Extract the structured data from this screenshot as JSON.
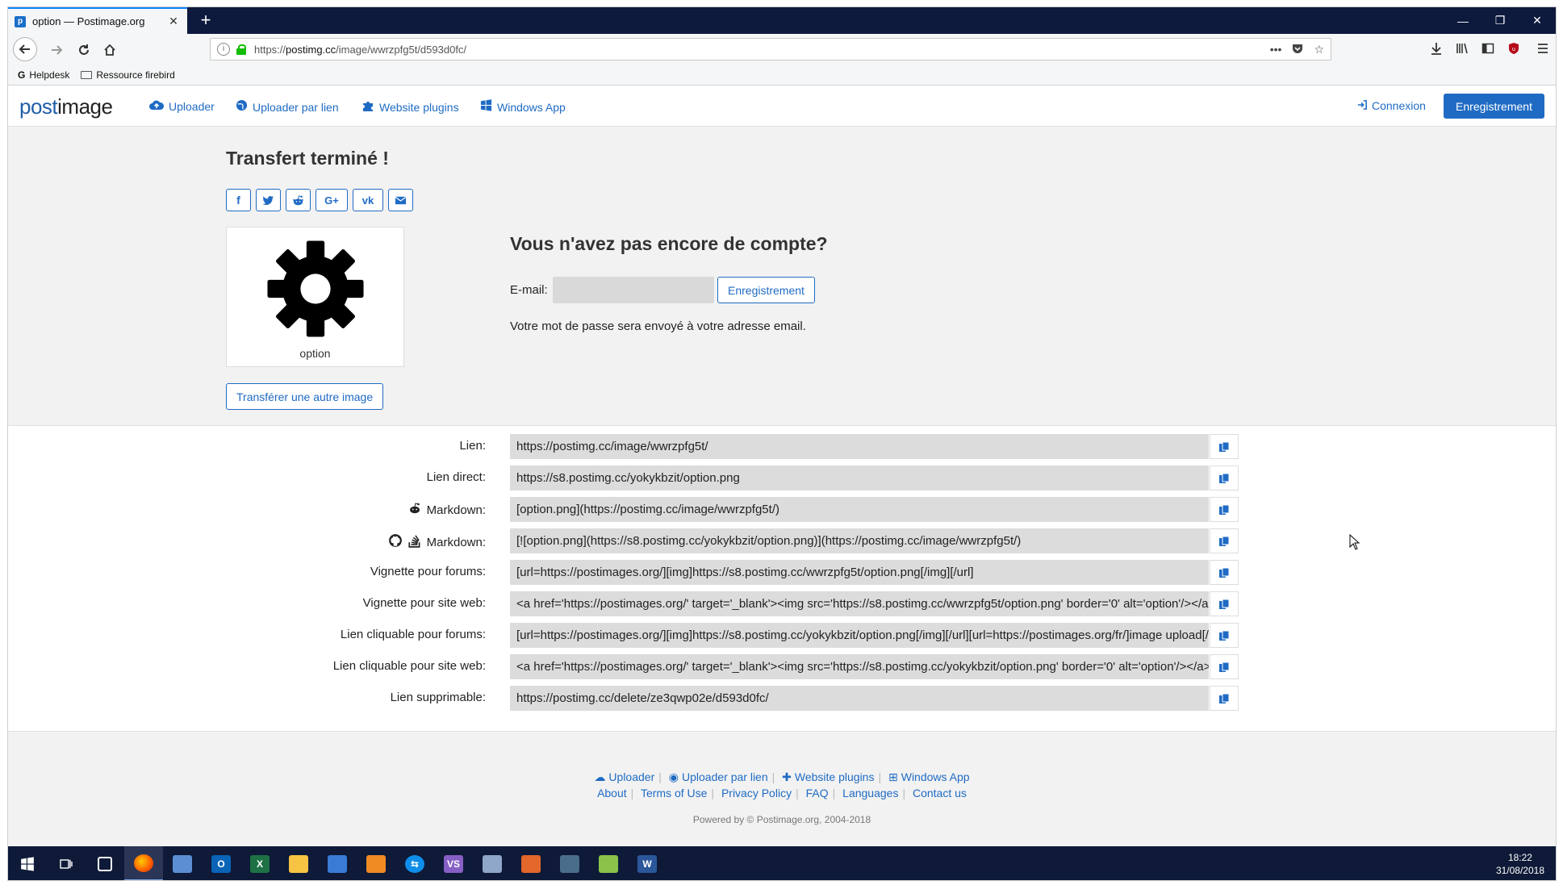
{
  "browser": {
    "tab_title": "option — Postimage.org",
    "url_prefix": "https://",
    "url_domain": "postimg.cc",
    "url_path": "/image/wwrzpfg5t/d593d0fc/",
    "bookmarks": [
      "Helpdesk",
      "Ressource firebird"
    ]
  },
  "header": {
    "logo_part1": "post",
    "logo_part2": "image",
    "nav": [
      "Uploader",
      "Uploader par lien",
      "Website plugins",
      "Windows App"
    ],
    "login": "Connexion",
    "register": "Enregistrement"
  },
  "upload": {
    "title": "Transfert terminé !",
    "share_buttons": [
      "facebook-icon",
      "twitter-icon",
      "reddit-icon",
      "google-plus-icon",
      "vk-icon",
      "email-icon"
    ],
    "thumb_label": "option",
    "another_button": "Transférer une autre image"
  },
  "account": {
    "title": "Vous n'avez pas encore de compte?",
    "email_label": "E-mail:",
    "email_value": "",
    "register_button": "Enregistrement",
    "password_note": "Votre mot de passe sera envoyé à votre adresse email."
  },
  "links": [
    {
      "label": "Lien:",
      "icon": "",
      "value": "https://postimg.cc/image/wwrzpfg5t/"
    },
    {
      "label": "Lien direct:",
      "icon": "",
      "value": "https://s8.postimg.cc/yokykbzit/option.png"
    },
    {
      "label": "Markdown:",
      "icon": "reddit-icon",
      "value": "[option.png](https://postimg.cc/image/wwrzpfg5t/)"
    },
    {
      "label": "Markdown:",
      "icon": "github-stackoverflow-icon",
      "value": "[![option.png](https://s8.postimg.cc/yokykbzit/option.png)](https://postimg.cc/image/wwrzpfg5t/)"
    },
    {
      "label": "Vignette pour forums:",
      "icon": "",
      "value": "[url=https://postimages.org/][img]https://s8.postimg.cc/wwrzpfg5t/option.png[/img][/url]"
    },
    {
      "label": "Vignette pour site web:",
      "icon": "",
      "value": "<a href='https://postimages.org/' target='_blank'><img src='https://s8.postimg.cc/wwrzpfg5t/option.png' border='0' alt='option'/></a>"
    },
    {
      "label": "Lien cliquable pour forums:",
      "icon": "",
      "value": "[url=https://postimages.org/][img]https://s8.postimg.cc/yokykbzit/option.png[/img][/url][url=https://postimages.org/fr/]image upload[/url]"
    },
    {
      "label": "Lien cliquable pour site web:",
      "icon": "",
      "value": "<a href='https://postimages.org/' target='_blank'><img src='https://s8.postimg.cc/yokykbzit/option.png' border='0' alt='option'/></a>"
    },
    {
      "label": "Lien supprimable:",
      "icon": "",
      "value": "https://postimg.cc/delete/ze3qwp02e/d593d0fc/"
    }
  ],
  "footer": {
    "nav1": [
      "Uploader",
      "Uploader par lien",
      "Website plugins",
      "Windows App"
    ],
    "nav2": [
      "About",
      "Terms of Use",
      "Privacy Policy",
      "FAQ",
      "Languages",
      "Contact us"
    ],
    "powered": "Powered by © Postimage.org, 2004-2018"
  },
  "taskbar": {
    "time": "18:22",
    "date": "31/08/2018"
  },
  "colors": {
    "accent": "#1f6bc4",
    "tabbar": "#0d1a3d",
    "taskbar": "#0e1a38"
  }
}
